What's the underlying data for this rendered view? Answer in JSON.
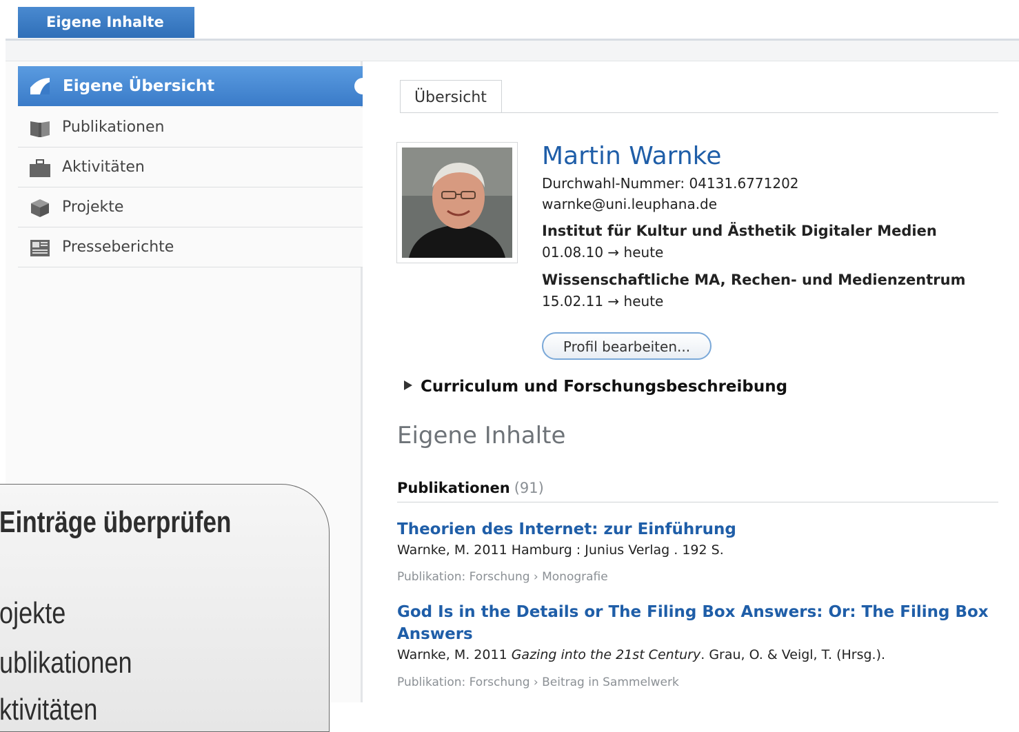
{
  "top_tab": {
    "label": "Eigene Inhalte"
  },
  "sidebar": {
    "items": [
      {
        "label": "Eigene Übersicht",
        "icon": "overview-icon",
        "active": true
      },
      {
        "label": "Publikationen",
        "icon": "book-icon"
      },
      {
        "label": "Aktivitäten",
        "icon": "briefcase-icon"
      },
      {
        "label": "Projekte",
        "icon": "cube-icon"
      },
      {
        "label": "Presseberichte",
        "icon": "newspaper-icon"
      }
    ]
  },
  "overlay": {
    "title": "Einträge überprüfen",
    "items": [
      "ojekte",
      "ublikationen",
      "ktivitäten"
    ]
  },
  "main": {
    "tab": "Übersicht",
    "profile": {
      "name": "Martin Warnke",
      "phone": "Durchwahl-Nummer: 04131.6771202",
      "email": "warnke@uni.leuphana.de",
      "affiliations": [
        {
          "org": "Institut für Kultur und Ästhetik Digitaler Medien",
          "period": "01.08.10 → heute"
        },
        {
          "org": "Wissenschaftliche MA, Rechen- und Medienzentrum",
          "period": "15.02.11 → heute"
        }
      ],
      "edit_button": "Profil bearbeiten..."
    },
    "curriculum": "Curriculum und Forschungsbeschreibung",
    "section_title": "Eigene Inhalte",
    "publications": {
      "heading": "Publikationen",
      "count": "(91)",
      "items": [
        {
          "title": "Theorien des Internet: zur Einführung",
          "meta": "Warnke, M. 2011 Hamburg : Junius Verlag . 192 S.",
          "category": "Publikation: Forschung › Monografie"
        },
        {
          "title": "God Is in the Details or The Filing Box Answers: Or: The Filing Box Answers",
          "meta_prefix": "Warnke, M. 2011 ",
          "meta_italic": "Gazing into the 21st Century",
          "meta_suffix": ". Grau, O. & Veigl, T. (Hrsg.).",
          "category": "Publikation: Forschung › Beitrag in Sammelwerk"
        }
      ]
    }
  }
}
